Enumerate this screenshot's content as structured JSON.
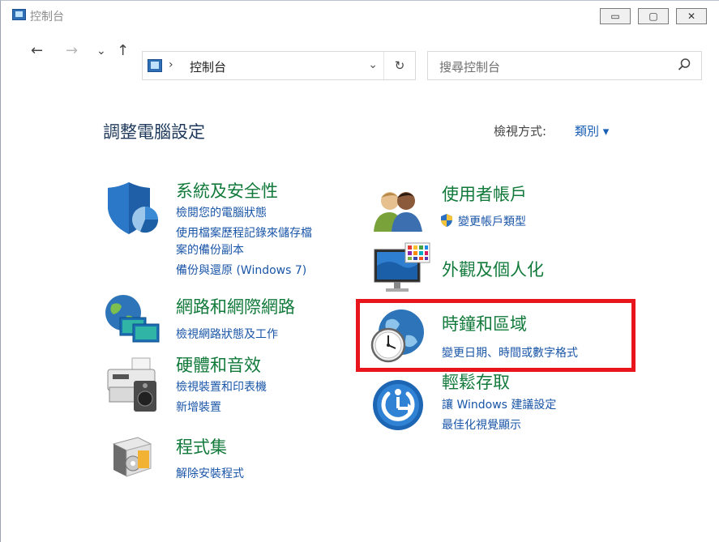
{
  "window": {
    "title": "控制台",
    "buttons": {
      "minimize": "▭",
      "maximize": "▢",
      "close": "✕"
    }
  },
  "nav": {
    "back": "←",
    "forward": "→",
    "recent": "⌄",
    "up": "↑",
    "address_sep": "›",
    "address": "控制台",
    "address_dropdown": "⌄",
    "refresh": "↻",
    "search_placeholder": "搜尋控制台"
  },
  "header": {
    "title": "調整電腦設定",
    "view_by_label": "檢視方式:",
    "view_by_value": "類別 ▾"
  },
  "categories": [
    {
      "title": "系統及安全性",
      "links": [
        "檢閱您的電腦狀態",
        "使用檔案歷程記錄來儲存檔",
        "案的備份副本",
        "備份與還原 (Windows 7)"
      ]
    },
    {
      "title": "網路和網際網路",
      "links": [
        "檢視網路狀態及工作"
      ]
    },
    {
      "title": "硬體和音效",
      "links": [
        "檢視裝置和印表機",
        "新增裝置"
      ]
    },
    {
      "title": "程式集",
      "links": [
        "解除安裝程式"
      ]
    },
    {
      "title": "使用者帳戶",
      "links": [
        "變更帳戶類型"
      ]
    },
    {
      "title": "外觀及個人化",
      "links": []
    },
    {
      "title": "時鐘和區域",
      "links": [
        "變更日期、時間或數字格式"
      ]
    },
    {
      "title": "輕鬆存取",
      "links": [
        "讓 Windows 建議設定",
        "最佳化視覺顯示"
      ]
    }
  ],
  "colors": {
    "category_title": "#117a3a",
    "link": "#1a56a8",
    "highlight": "#e8161c"
  }
}
